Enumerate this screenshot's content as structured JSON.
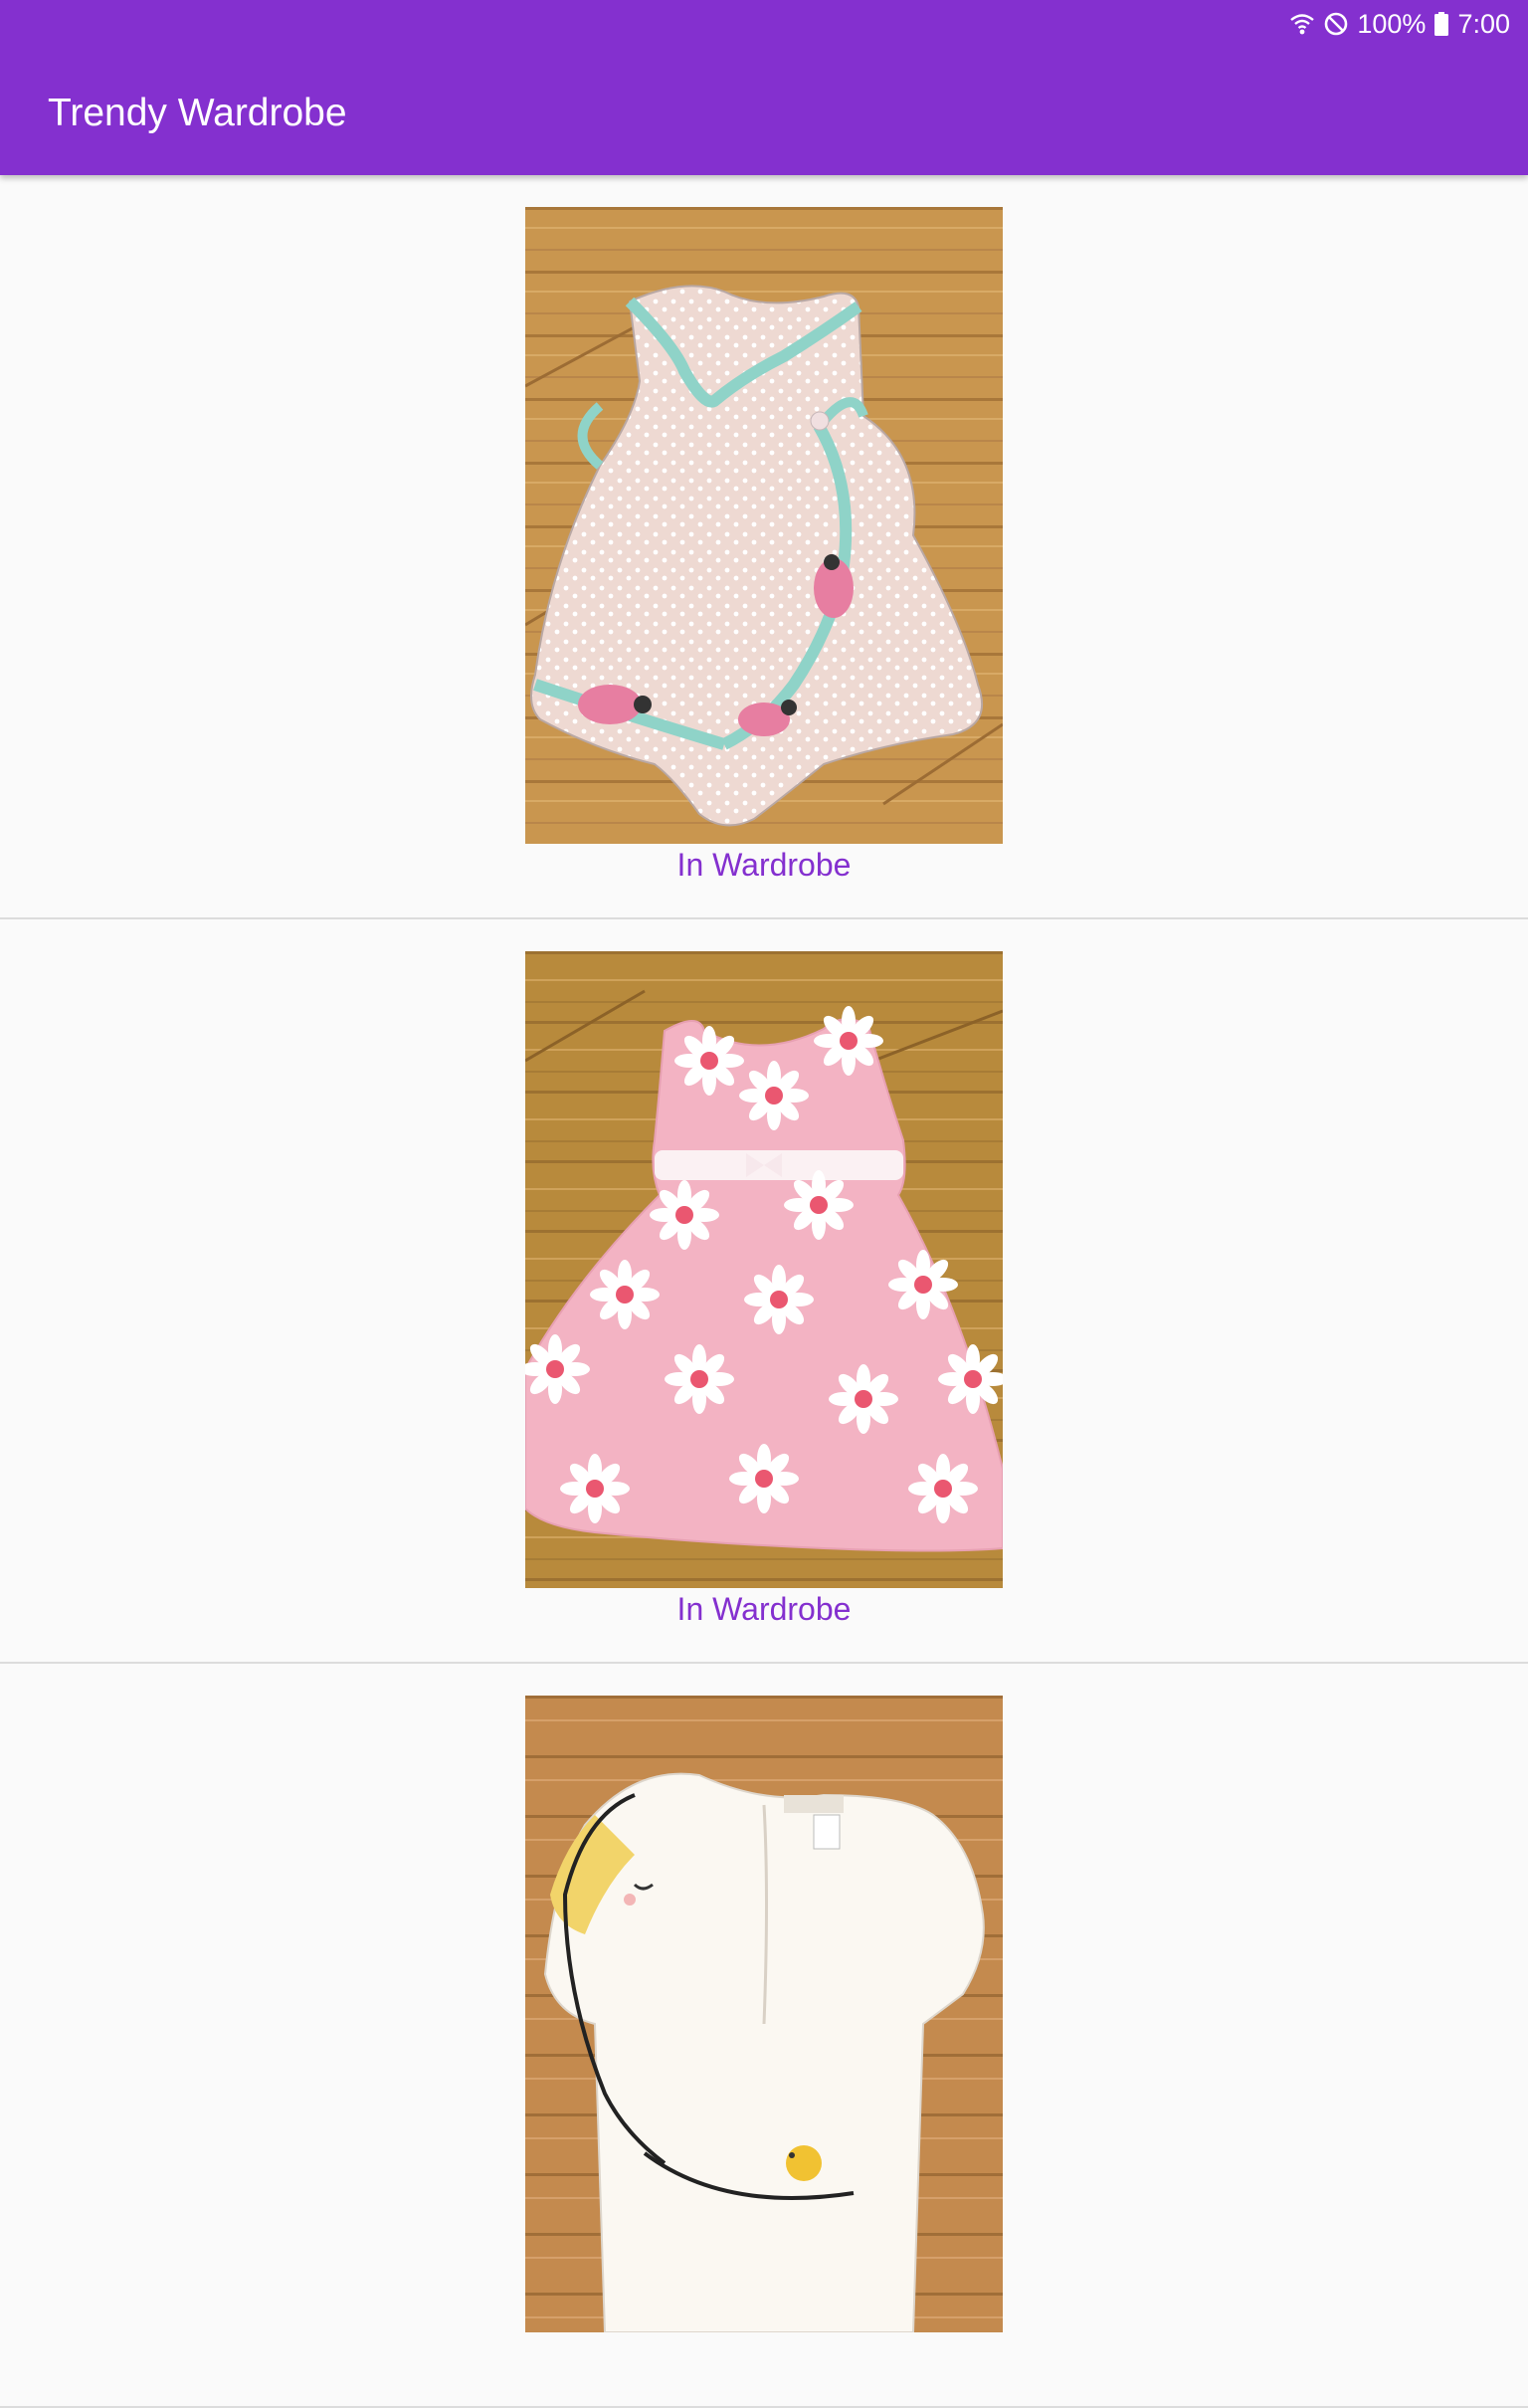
{
  "status_bar": {
    "battery": "100%",
    "time": "7:00",
    "icons": [
      "wifi-icon",
      "do-not-disturb-icon",
      "battery-icon"
    ]
  },
  "app_bar": {
    "title": "Trendy Wardrobe",
    "background": "#8430cf"
  },
  "items": [
    {
      "status": "In Wardrobe",
      "photo": "pink-ladybug-romper"
    },
    {
      "status": "In Wardrobe",
      "photo": "pink-daisy-dress"
    },
    {
      "status": "",
      "photo": "white-bird-onesie"
    }
  ],
  "colors": {
    "accent": "#8430cf",
    "divider": "#dcdcdc",
    "background": "#fafafa"
  }
}
